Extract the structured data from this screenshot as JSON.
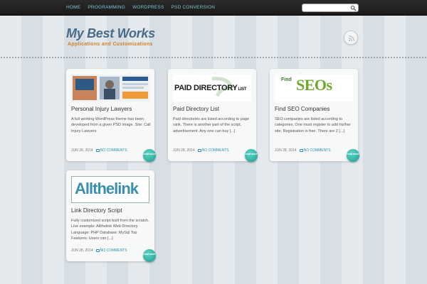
{
  "nav": {
    "items": [
      "HOME",
      "PROGRAMMING",
      "WORDPRESS",
      "PSD CONVERSION"
    ]
  },
  "search": {
    "placeholder": "",
    "value": "",
    "icon": "search-icon"
  },
  "header": {
    "title": "My Best Works",
    "tagline": "Applications and Customizations",
    "rss_icon": "rss-icon"
  },
  "colors": {
    "accent": "#2a8fb6",
    "title": "#4a6a8a",
    "tagline": "#d2802c",
    "read_more": "#1b9e90"
  },
  "posts": [
    {
      "title": "Personal Injury Lawyers",
      "excerpt": "A full working WordPress theme has been developed from a given PSD image. Site: Call Injury Lawyers",
      "date": "JUN 28, 2014",
      "comments": "NO COMMENTS",
      "read_more": "read more",
      "thumb_text": ""
    },
    {
      "title": "Paid Directory List",
      "excerpt": "Paid directories are listed according to page rank. There is another part of the script, advertisement. Any one can buy [...]",
      "date": "JUN 28, 2014",
      "comments": "NO COMMENTS",
      "read_more": "read more",
      "thumb_text": "PAID DIRECTORY",
      "thumb_small": "LIST"
    },
    {
      "title": "Find SEO Companies",
      "excerpt": "SEO companies are listed according to categories. One must register to add his/her site. Registration is free. There are 2 [...]",
      "date": "JUN 28, 2014",
      "comments": "NO COMMENTS",
      "read_more": "read more",
      "thumb_text": "SEOs",
      "thumb_small": "Find"
    },
    {
      "title": "Link Directory Script",
      "excerpt": "Fully customized script built from the scratch. Live example: Allthelink Web Directory Language: PHP Database: MySql Top Features: Users can [...]",
      "date": "JUN 28, 2014",
      "comments": "NO COMMENTS",
      "read_more": "read more",
      "thumb_text": "Allthelink"
    }
  ]
}
